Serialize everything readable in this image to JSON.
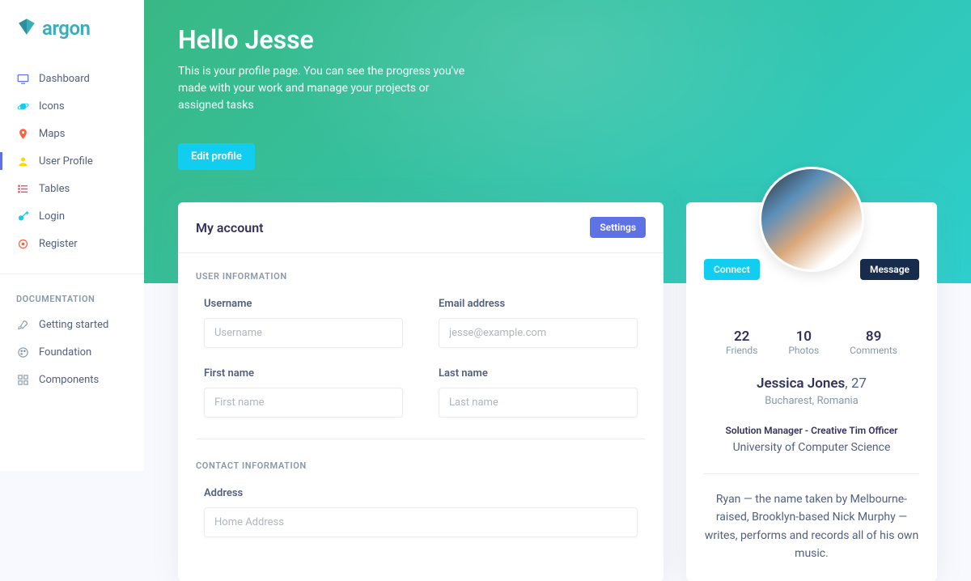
{
  "brand": {
    "name": "argon"
  },
  "sidebar": {
    "items": [
      {
        "label": "Dashboard",
        "iconColor": "#5e72e4"
      },
      {
        "label": "Icons",
        "iconColor": "#11cdef"
      },
      {
        "label": "Maps",
        "iconColor": "#f5365c"
      },
      {
        "label": "User Profile",
        "iconColor": "#ffd600"
      },
      {
        "label": "Tables",
        "iconColor": "#f5365c"
      },
      {
        "label": "Login",
        "iconColor": "#11cdef"
      },
      {
        "label": "Register",
        "iconColor": "#fb6340"
      }
    ],
    "docHeading": "DOCUMENTATION",
    "docs": [
      {
        "label": "Getting started"
      },
      {
        "label": "Foundation"
      },
      {
        "label": "Components"
      }
    ]
  },
  "header": {
    "title": "Hello Jesse",
    "subtitle": "This is your profile page. You can see the progress you've made with your work and manage your projects or assigned tasks",
    "editBtn": "Edit profile"
  },
  "account": {
    "title": "My account",
    "settingsBtn": "Settings",
    "userInfoHeading": "USER INFORMATION",
    "contactInfoHeading": "CONTACT INFORMATION",
    "fields": {
      "usernameLabel": "Username",
      "usernamePlaceholder": "Username",
      "emailLabel": "Email address",
      "emailPlaceholder": "jesse@example.com",
      "firstNameLabel": "First name",
      "firstNamePlaceholder": "First name",
      "lastNameLabel": "Last name",
      "lastNamePlaceholder": "Last name",
      "addressLabel": "Address",
      "addressPlaceholder": "Home Address"
    }
  },
  "profile": {
    "connectBtn": "Connect",
    "messageBtn": "Message",
    "stats": [
      {
        "num": "22",
        "label": "Friends"
      },
      {
        "num": "10",
        "label": "Photos"
      },
      {
        "num": "89",
        "label": "Comments"
      }
    ],
    "name": "Jessica Jones",
    "age": "27",
    "location": "Bucharest, Romania",
    "role": "Solution Manager - Creative Tim Officer",
    "education": "University of Computer Science",
    "bio": "Ryan — the name taken by Melbourne-raised, Brooklyn-based Nick Murphy — writes, performs and records all of his own music."
  }
}
